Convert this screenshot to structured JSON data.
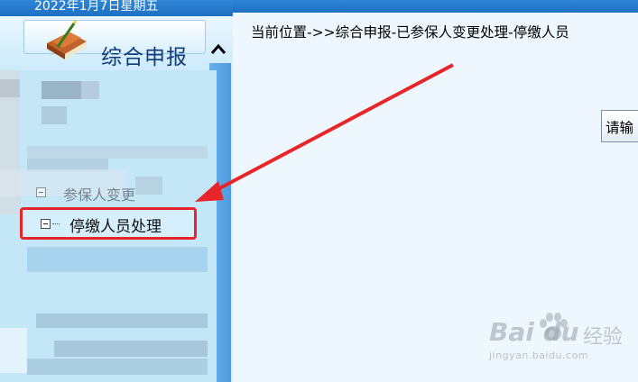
{
  "sidebar": {
    "date": "2022年1月7日星期五",
    "section_title": "综合申报",
    "collapse_icon": "chevron-up-icon",
    "partial_item_label": "参保人变更",
    "active_item": {
      "label": "停缴人员处理",
      "expander_icon": "minus-box-icon"
    }
  },
  "main": {
    "breadcrumb": "当前位置->>综合申报-已参保人变更处理-停缴人员",
    "input_button_label": "请输"
  },
  "watermark": {
    "brand": "Bai du",
    "cn": "经验",
    "url": "jingyan.baidu.com"
  },
  "annotation": {
    "arrow_color": "#e8262a",
    "highlight_color": "#e8262a"
  },
  "colors": {
    "sidebar_blue": "#1e6fc2",
    "content_bg": "#eef7fe"
  }
}
